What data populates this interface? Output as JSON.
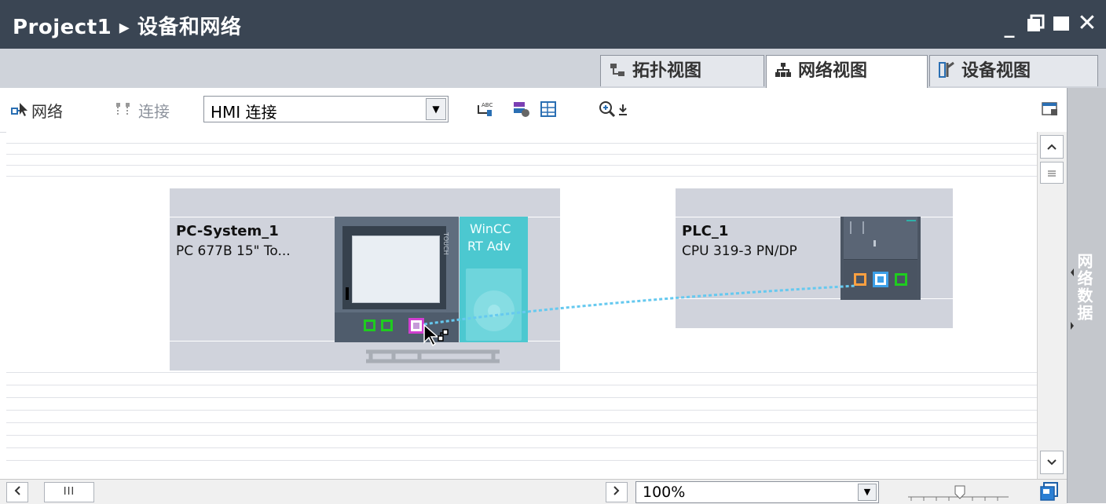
{
  "window": {
    "title": "Project1 ▸ 设备和网络",
    "btn_minimize": "_",
    "btn_float": "▪",
    "btn_maximize": "▬",
    "btn_close": "✕"
  },
  "tabs": [
    {
      "label": "拓扑视图",
      "icon": "topology-icon",
      "active": false
    },
    {
      "label": "网络视图",
      "icon": "network-icon",
      "active": true
    },
    {
      "label": "设备视图",
      "icon": "device-icon",
      "active": false
    }
  ],
  "toolbar": {
    "network_label": "网络",
    "connect_label": "连接",
    "connection_type_value": "HMI 连接",
    "zoom_icon": "zoom-in-icon"
  },
  "devices": [
    {
      "name": "PC-System_1",
      "type": "PC 677B 15\" To...",
      "runtime_line1": "WinCC",
      "runtime_line2": "RT Adv",
      "touch_label": "TOUCH"
    },
    {
      "name": "PLC_1",
      "type": "CPU 319-3 PN/DP"
    }
  ],
  "right_panel": {
    "label": "网络数据"
  },
  "statusbar": {
    "zoom_value": "100%",
    "scroll_grip": "III"
  },
  "colors": {
    "title_bg": "#3a4553",
    "device_bg": "#d0d3dc",
    "runtime_bg": "#4cc8d0",
    "port_green": "#1fcc1f",
    "port_orange": "#ffa040",
    "port_blue": "#3da0e8",
    "link_cyan": "#66c9ef"
  }
}
